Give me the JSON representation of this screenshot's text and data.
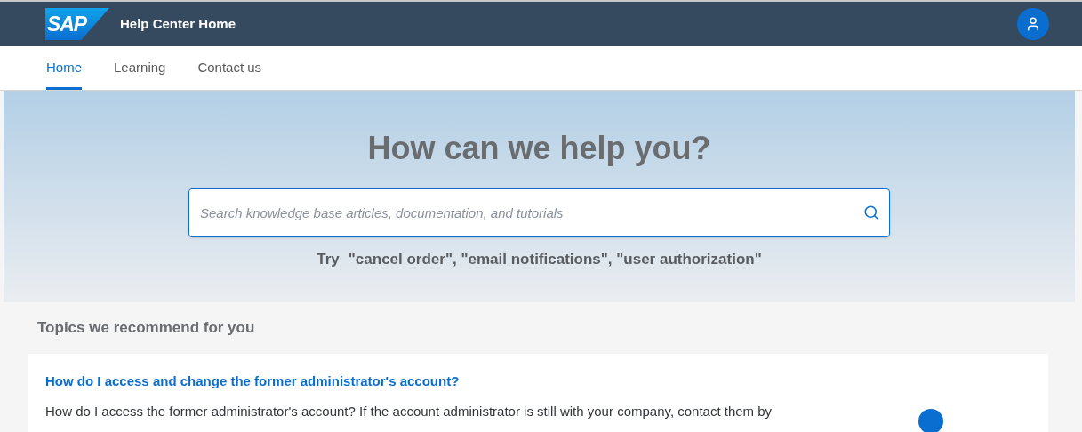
{
  "header": {
    "logo": "SAP",
    "title": "Help Center Home"
  },
  "tabs": [
    {
      "label": "Home",
      "selected": true
    },
    {
      "label": "Learning",
      "selected": false
    },
    {
      "label": "Contact us",
      "selected": false
    }
  ],
  "hero": {
    "heading": "How can we help you?",
    "search": {
      "placeholder": "Search knowledge base articles, documentation, and tutorials"
    },
    "try_label": "Try",
    "suggestions": "\"cancel order\", \"email notifications\", \"user authorization\""
  },
  "topics": {
    "heading": "Topics we recommend for you",
    "items": [
      {
        "title": "How do I access and change the former administrator's account?",
        "excerpt": "How do I access the former administrator's account? If the account administrator is still with your company, contact them by"
      }
    ]
  }
}
